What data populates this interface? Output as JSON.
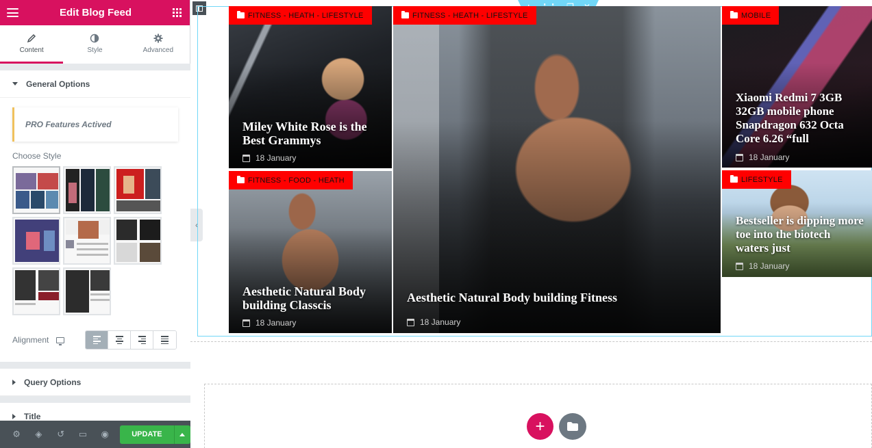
{
  "panel": {
    "title": "Edit Blog Feed",
    "tabs": [
      {
        "label": "Content",
        "icon": "pencil-icon",
        "active": true
      },
      {
        "label": "Style",
        "icon": "contrast-icon",
        "active": false
      },
      {
        "label": "Advanced",
        "icon": "gear-icon",
        "active": false
      }
    ],
    "general_options": "General Options",
    "pro_notice": "PRO Features Actived",
    "choose_style": "Choose Style",
    "alignment": "Alignment",
    "alignment_selected": "left",
    "query_options": "Query Options",
    "title_section": "Title",
    "update_label": "UPDATE"
  },
  "footer_icons": [
    "settings-icon",
    "layers-icon",
    "history-icon",
    "responsive-icon",
    "preview-eye-icon"
  ],
  "posts": [
    {
      "category": "FITNESS - HEATH - LIFESTYLE",
      "title": "Miley White Rose is the Best Grammys",
      "date": "18 January"
    },
    {
      "category": "FITNESS - HEATH - LIFESTYLE",
      "title": "Aesthetic Natural Body building Fitness",
      "date": "18 January"
    },
    {
      "category": "MOBILE",
      "title": "Xiaomi Redmi 7 3GB 32GB mobile phone Snapdragon 632 Octa Core 6.26 “full",
      "date": "18 January"
    },
    {
      "category": "FITNESS - FOOD - HEATH",
      "title": "Aesthetic Natural Body building Classcis",
      "date": "18 January"
    },
    {
      "category": "LIFESTYLE",
      "title": "Bestseller is dipping more toe into the biotech waters just",
      "date": "18 January"
    }
  ],
  "colors": {
    "brand": "#d8115f",
    "category_badge": "#ff0000",
    "update": "#39b54a",
    "outline": "#71d7f7"
  }
}
